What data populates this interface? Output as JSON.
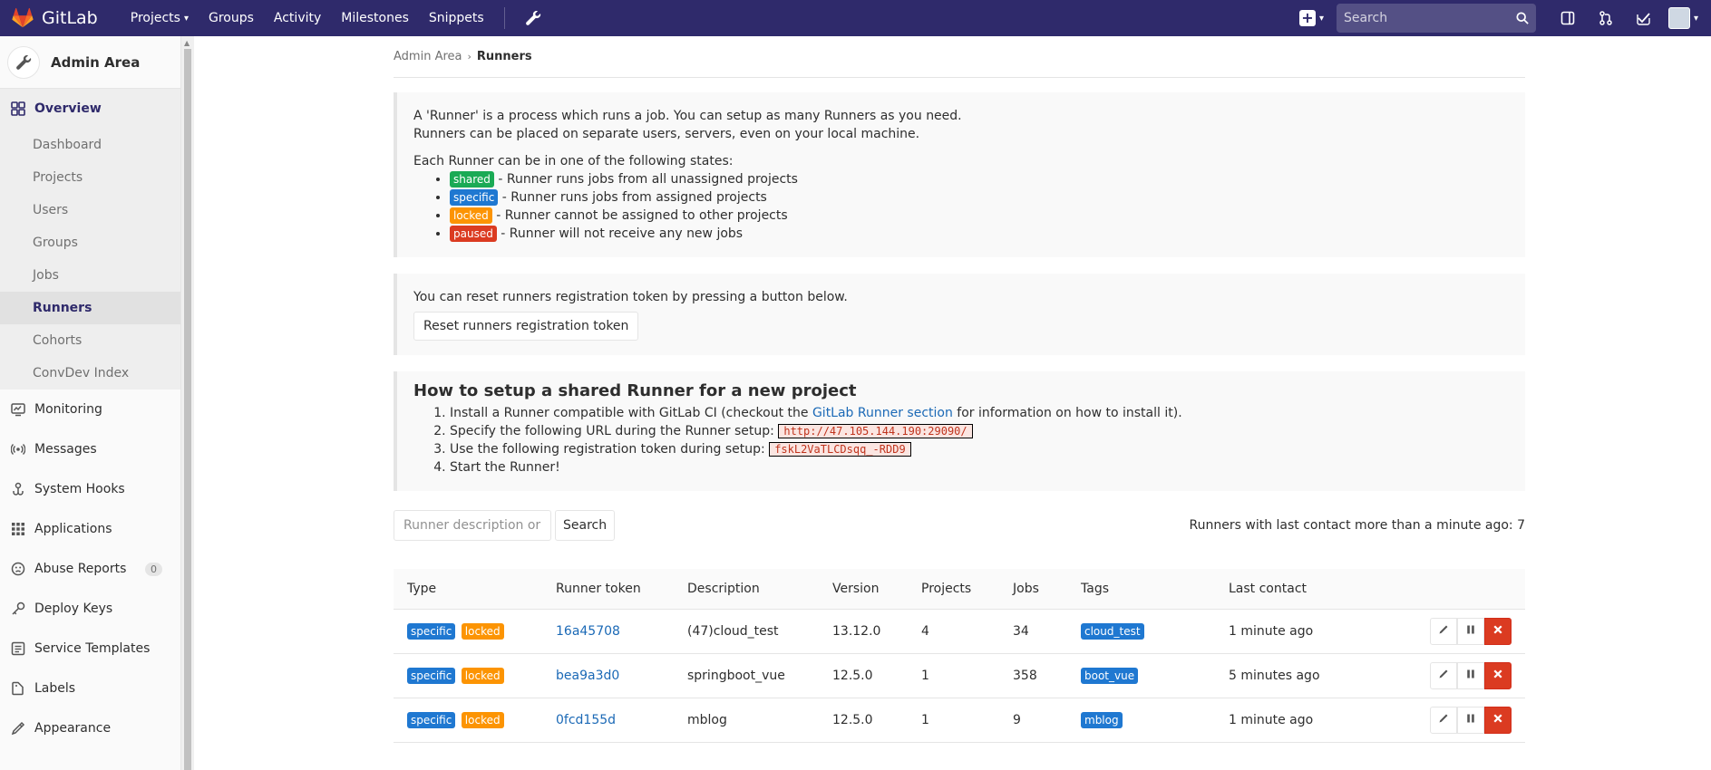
{
  "navbar": {
    "brand": "GitLab",
    "links": [
      "Projects",
      "Groups",
      "Activity",
      "Milestones",
      "Snippets"
    ],
    "search_placeholder": "Search"
  },
  "sidebar": {
    "context_title": "Admin Area",
    "overview_label": "Overview",
    "overview_items": [
      "Dashboard",
      "Projects",
      "Users",
      "Groups",
      "Jobs",
      "Runners",
      "Cohorts",
      "ConvDev Index"
    ],
    "sections": [
      {
        "label": "Monitoring",
        "icon": "monitor-icon"
      },
      {
        "label": "Messages",
        "icon": "broadcast-icon"
      },
      {
        "label": "System Hooks",
        "icon": "hook-icon"
      },
      {
        "label": "Applications",
        "icon": "grid-icon"
      },
      {
        "label": "Abuse Reports",
        "icon": "face-icon",
        "badge": "0"
      },
      {
        "label": "Deploy Keys",
        "icon": "key-icon"
      },
      {
        "label": "Service Templates",
        "icon": "template-icon"
      },
      {
        "label": "Labels",
        "icon": "label-icon"
      },
      {
        "label": "Appearance",
        "icon": "appearance-icon"
      }
    ]
  },
  "breadcrumb": {
    "root": "Admin Area",
    "current": "Runners"
  },
  "intro": {
    "line1": "A 'Runner' is a process which runs a job. You can setup as many Runners as you need.",
    "line2": "Runners can be placed on separate users, servers, even on your local machine.",
    "states_heading": "Each Runner can be in one of the following states:",
    "states": [
      {
        "label": "shared",
        "text": " - Runner runs jobs from all unassigned projects"
      },
      {
        "label": "specific",
        "text": " - Runner runs jobs from assigned projects"
      },
      {
        "label": "locked",
        "text": " - Runner cannot be assigned to other projects"
      },
      {
        "label": "paused",
        "text": " - Runner will not receive any new jobs"
      }
    ]
  },
  "reset": {
    "text": "You can reset runners registration token by pressing a button below.",
    "button": "Reset runners registration token"
  },
  "setup": {
    "title": "How to setup a shared Runner for a new project",
    "step1_pre": "Install a Runner compatible with GitLab CI (checkout the ",
    "step1_link": "GitLab Runner section",
    "step1_post": " for information on how to install it).",
    "step2": "Specify the following URL during the Runner setup: ",
    "url": "http://47.105.144.190:29090/",
    "step3": "Use the following registration token during setup: ",
    "token": "fskL2VaTLCDsqq_-RDD9",
    "step4": "Start the Runner!"
  },
  "filter": {
    "placeholder": "Runner description or token",
    "button": "Search",
    "count_text": "Runners with last contact more than a minute ago: 7"
  },
  "table": {
    "headers": [
      "Type",
      "Runner token",
      "Description",
      "Version",
      "Projects",
      "Jobs",
      "Tags",
      "Last contact",
      ""
    ],
    "rows": [
      {
        "types": [
          "specific",
          "locked"
        ],
        "token": "16a45708",
        "description": "(47)cloud_test",
        "version": "13.12.0",
        "projects": "4",
        "jobs": "34",
        "tag": "cloud_test",
        "last_contact": "1 minute ago"
      },
      {
        "types": [
          "specific",
          "locked"
        ],
        "token": "bea9a3d0",
        "description": "springboot_vue",
        "version": "12.5.0",
        "projects": "1",
        "jobs": "358",
        "tag": "boot_vue",
        "last_contact": "5 minutes ago"
      },
      {
        "types": [
          "specific",
          "locked"
        ],
        "token": "0fcd155d",
        "description": "mblog",
        "version": "12.5.0",
        "projects": "1",
        "jobs": "9",
        "tag": "mblog",
        "last_contact": "1 minute ago"
      }
    ]
  },
  "colors": {
    "navbar": "#2f2a6b",
    "shared": "#1aaa55",
    "specific": "#1f78d1",
    "locked": "#fc9403",
    "paused": "#db3b21",
    "link": "#1b69b6"
  }
}
